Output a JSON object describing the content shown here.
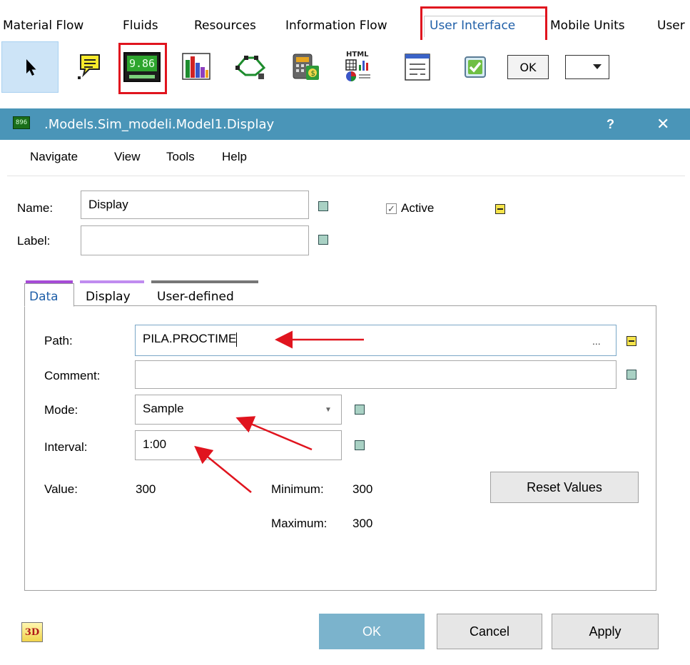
{
  "ribbon": {
    "tabs": [
      "Material Flow",
      "Fluids",
      "Resources",
      "Information Flow",
      "User Interface",
      "Mobile Units",
      "User"
    ],
    "active_tab": "User Interface"
  },
  "toolbar": {
    "display_icon_text": "9.86",
    "ok_button_label": "OK",
    "tools": [
      "pointer",
      "comment",
      "display",
      "chart",
      "sankey",
      "calculator",
      "html-report",
      "dialog",
      "checkbox",
      "ok-button",
      "dropdown"
    ]
  },
  "dialog": {
    "icon_text": "896",
    "title": ".Models.Sim_modeli.Model1.Display",
    "help": "?",
    "close": "✕",
    "menu": [
      "Navigate",
      "View",
      "Tools",
      "Help"
    ],
    "name_label": "Name:",
    "name_value": "Display",
    "label_label": "Label:",
    "label_value": "",
    "active_label": "Active",
    "active_checked": true,
    "tabs": [
      "Data",
      "Display",
      "User-defined"
    ],
    "tab_colors": [
      "#a64bd6",
      "#c08cf0",
      "#777777"
    ],
    "data": {
      "path_label": "Path:",
      "path_value": "PILA.PROCTIME",
      "path_browse": "...",
      "comment_label": "Comment:",
      "comment_value": "",
      "mode_label": "Mode:",
      "mode_value": "Sample",
      "interval_label": "Interval:",
      "interval_value": "1:00",
      "value_label": "Value:",
      "value_value": "300",
      "minimum_label": "Minimum:",
      "minimum_value": "300",
      "maximum_label": "Maximum:",
      "maximum_value": "300",
      "reset_label": "Reset Values"
    },
    "footer": {
      "threed_label": "3D",
      "ok_label": "OK",
      "cancel_label": "Cancel",
      "apply_label": "Apply"
    }
  },
  "colors": {
    "titlebar": "#4a95b8",
    "highlight": "#e0141e",
    "active_tab_text": "#1f5fa8",
    "ok_button": "#7bb3cc"
  }
}
